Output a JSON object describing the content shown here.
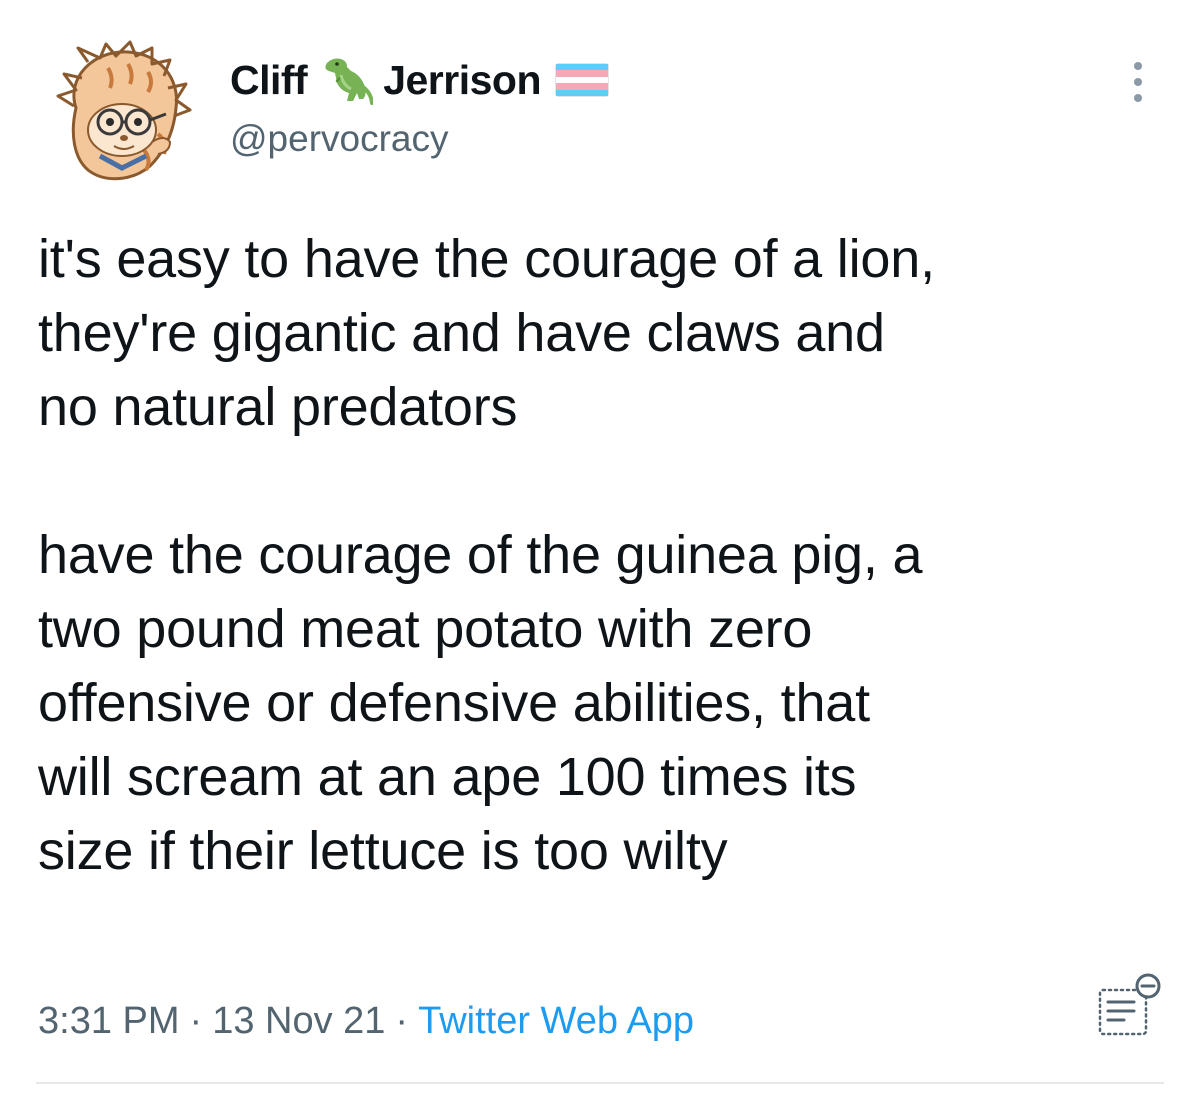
{
  "tweet": {
    "author": {
      "name_first": "Cliff",
      "name_emoji": "t-rex-emoji",
      "name_last": "Jerrison",
      "name_flag": "transgender-flag-emoji",
      "handle": "@pervocracy",
      "avatar": "cartoon-guinea-pig-with-glasses-avatar"
    },
    "text": "it's easy to have the courage of a lion,\nthey're gigantic and have claws and\nno natural predators\n\nhave the courage of the guinea pig, a\ntwo pound meat potato with zero\noffensive or defensive abilities, that\nwill scream at an ape 100 times its\nsize if their lettuce is too wilty",
    "time": "3:31 PM",
    "separator": "·",
    "date": "13 Nov 21",
    "source": "Twitter Web App",
    "more_icon": "vertical-ellipsis-icon",
    "analytics_icon": "tweet-analytics-icon"
  },
  "colors": {
    "text": "#0f1419",
    "secondary": "#536471",
    "link": "#1d9bf0",
    "divider": "#e6e9ea",
    "flag_blue": "#5bcefa",
    "flag_pink": "#f5a9b8",
    "flag_white": "#ffffff"
  }
}
